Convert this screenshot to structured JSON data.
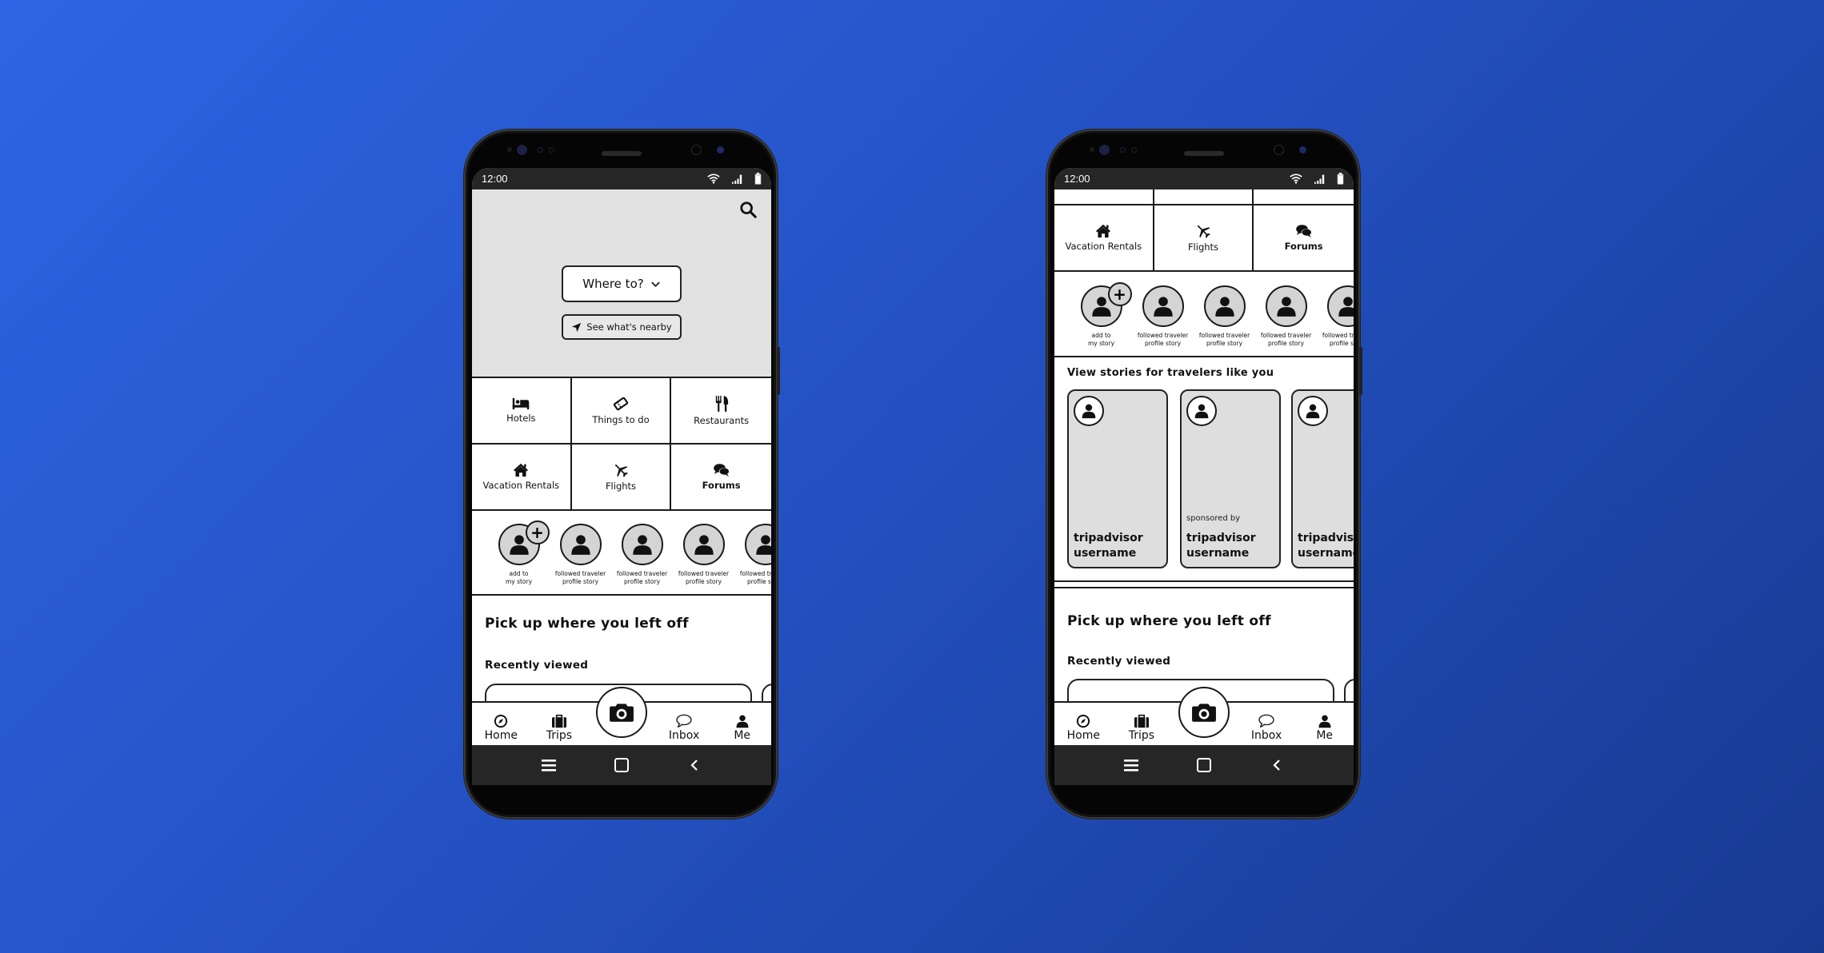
{
  "background": {
    "gradient_start": "#2e64e3",
    "gradient_end": "#173a91"
  },
  "phones": [
    {
      "status_bar": {
        "time": "12:00",
        "icons": [
          "wifi-icon",
          "signal-icon",
          "battery-icon"
        ]
      },
      "hero": {
        "search_icon": "search-icon",
        "where_to_label": "Where to?",
        "where_to_icon": "chevron-down-icon",
        "nearby_label": "See what's nearby",
        "nearby_icon": "location-arrow-icon"
      },
      "categories": [
        {
          "label": "Hotels",
          "icon": "bed-icon"
        },
        {
          "label": "Things to do",
          "icon": "ticket-icon"
        },
        {
          "label": "Restaurants",
          "icon": "utensils-icon"
        },
        {
          "label": "Vacation Rentals",
          "icon": "house-icon"
        },
        {
          "label": "Flights",
          "icon": "plane-icon"
        },
        {
          "label": "Forums",
          "icon": "chat-bubbles-icon"
        }
      ],
      "stories": [
        {
          "label": "add to\nmy story",
          "add": true
        },
        {
          "label": "followed traveler\nprofile story"
        },
        {
          "label": "followed traveler\nprofile story"
        },
        {
          "label": "followed traveler\nprofile story"
        },
        {
          "label": "followed traveler\nprofile story"
        }
      ],
      "pick_up_title": "Pick up where you left off",
      "recently_viewed": "Recently viewed",
      "tabbar": [
        {
          "label": "Home",
          "icon": "compass-icon"
        },
        {
          "label": "Trips",
          "icon": "suitcase-icon"
        },
        {
          "label": "Inbox",
          "icon": "chat-icon"
        },
        {
          "label": "Me",
          "icon": "person-icon"
        }
      ],
      "camera_icon": "camera-icon",
      "navbar": [
        "menu-icon",
        "home-square-icon",
        "back-icon"
      ]
    },
    {
      "status_bar": {
        "time": "12:00"
      },
      "categories": [
        {
          "label": "Vacation Rentals",
          "icon": "house-icon"
        },
        {
          "label": "Flights",
          "icon": "plane-icon"
        },
        {
          "label": "Forums",
          "icon": "chat-bubbles-icon"
        }
      ],
      "stories": [
        {
          "label": "add to\nmy story",
          "add": true
        },
        {
          "label": "followed traveler\nprofile story"
        },
        {
          "label": "followed traveler\nprofile story"
        },
        {
          "label": "followed traveler\nprofile story"
        },
        {
          "label": "followed traveler\nprofile story"
        }
      ],
      "traveler_stories_title": "View stories for travelers like you",
      "traveler_cards": [
        {
          "username": "tripadvisor\nusername",
          "sponsored": ""
        },
        {
          "username": "tripadvisor\nusername",
          "sponsored": "sponsored by"
        },
        {
          "username": "tripadvisor\nusername",
          "sponsored": ""
        }
      ],
      "pick_up_title": "Pick up where you left off",
      "recently_viewed": "Recently viewed",
      "tabbar": [
        {
          "label": "Home",
          "icon": "compass-icon"
        },
        {
          "label": "Trips",
          "icon": "suitcase-icon"
        },
        {
          "label": "Inbox",
          "icon": "chat-icon"
        },
        {
          "label": "Me",
          "icon": "person-icon"
        }
      ]
    }
  ]
}
